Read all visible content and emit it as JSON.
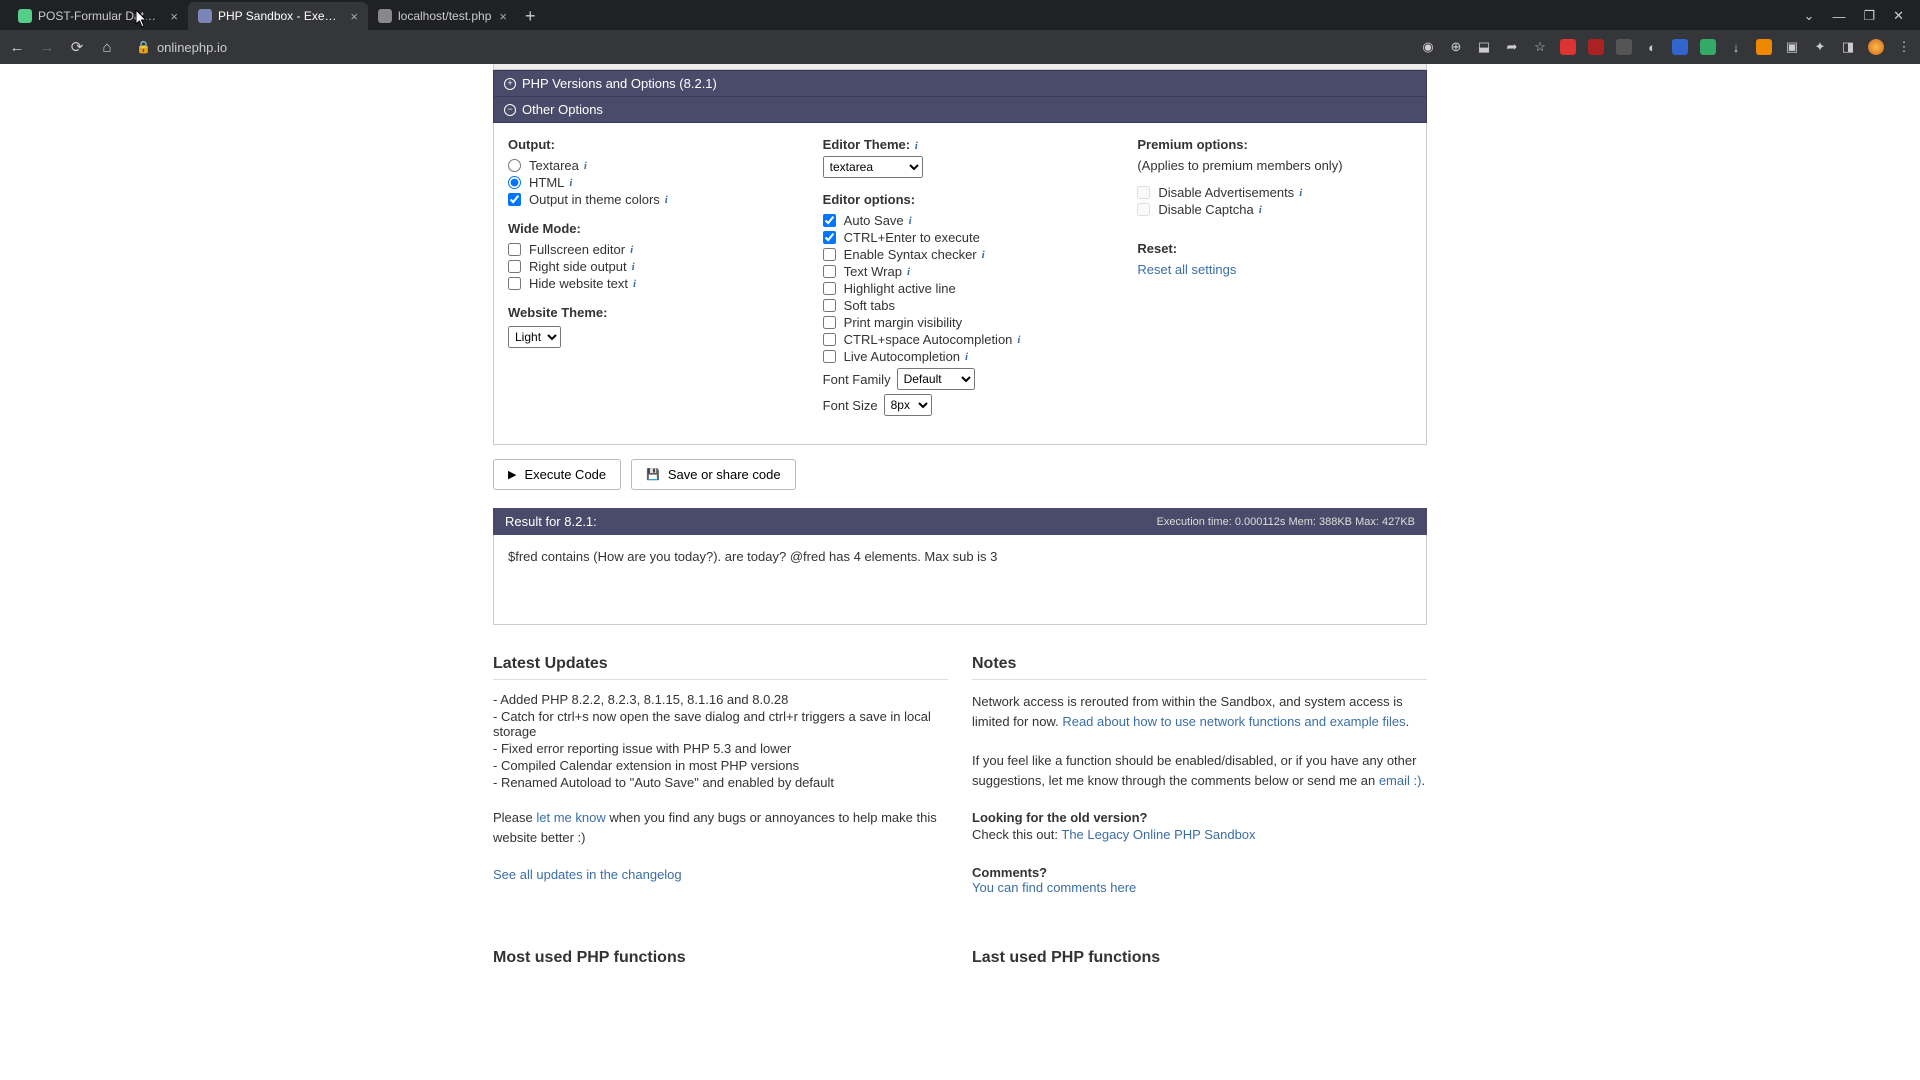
{
  "browser": {
    "tabs": [
      {
        "title": "POST-Formular Daten verarbeiten"
      },
      {
        "title": "PHP Sandbox - Execute PHP code"
      },
      {
        "title": "localhost/test.php"
      }
    ],
    "url": "onlinephp.io",
    "win": {
      "min": "—",
      "max": "❐",
      "close": "✕",
      "chev": "⌄"
    }
  },
  "panels": {
    "versions": "PHP Versions and Options (8.2.1)",
    "other": "Other Options"
  },
  "output": {
    "heading": "Output:",
    "textarea": "Textarea",
    "html": "HTML",
    "themecolors": "Output in theme colors"
  },
  "wide": {
    "heading": "Wide Mode:",
    "fullscreen": "Fullscreen editor",
    "rightside": "Right side output",
    "hidetext": "Hide website text"
  },
  "website_theme": {
    "heading": "Website Theme:",
    "value": "Light"
  },
  "editor_theme": {
    "heading": "Editor Theme:",
    "value": "textarea"
  },
  "editor_options": {
    "heading": "Editor options:",
    "autosave": "Auto Save",
    "ctrlenter": "CTRL+Enter to execute",
    "syntax": "Enable Syntax checker",
    "textwrap": "Text Wrap",
    "highlight": "Highlight active line",
    "softtabs": "Soft tabs",
    "printmargin": "Print margin visibility",
    "ctrlspace": "CTRL+space Autocompletion",
    "liveauto": "Live Autocompletion",
    "fontfamily_label": "Font Family",
    "fontfamily_value": "Default",
    "fontsize_label": "Font Size",
    "fontsize_value": "8px"
  },
  "premium": {
    "heading": "Premium options:",
    "sub": "(Applies to premium members only)",
    "ads": "Disable Advertisements",
    "captcha": "Disable Captcha"
  },
  "reset": {
    "heading": "Reset:",
    "link": "Reset all settings"
  },
  "buttons": {
    "execute": "Execute Code",
    "save": "Save or share code"
  },
  "result": {
    "header": "Result for 8.2.1:",
    "stats": "Execution time: 0.000112s Mem: 388KB Max: 427KB",
    "body": "$fred contains (How are you today?). are today? @fred has 4 elements. Max sub is 3"
  },
  "updates": {
    "heading": "Latest Updates",
    "items": [
      "- Added PHP 8.2.2, 8.2.3, 8.1.15, 8.1.16 and 8.0.28",
      "- Catch for ctrl+s now open the save dialog and ctrl+r triggers a save in local storage",
      "- Fixed error reporting issue with PHP 5.3 and lower",
      "- Compiled Calendar extension in most PHP versions",
      "- Renamed Autoload to \"Auto Save\" and enabled by default"
    ],
    "please_pre": "Please ",
    "please_link": "let me know",
    "please_post": " when you find any bugs or annoyances to help make this website better :)",
    "changelog": "See all updates in the changelog"
  },
  "notes": {
    "heading": "Notes",
    "p1_pre": "Network access is rerouted from within the Sandbox, and system access is limited for now. ",
    "p1_link": "Read about how to use network functions and example files",
    "p1_post": ".",
    "p2_pre": "If you feel like a function should be enabled/disabled, or if you have any other suggestions, let me know through the comments below or send me an ",
    "p2_link": "email :)",
    "p2_post": ".",
    "old_h": "Looking for the old version?",
    "old_pre": "Check this out: ",
    "old_link": "The Legacy Online PHP Sandbox",
    "comments_h": "Comments?",
    "comments_link": "You can find comments here"
  },
  "cutoff": {
    "left": "Most used PHP functions",
    "right": "Last used PHP functions"
  },
  "info_i": "i"
}
